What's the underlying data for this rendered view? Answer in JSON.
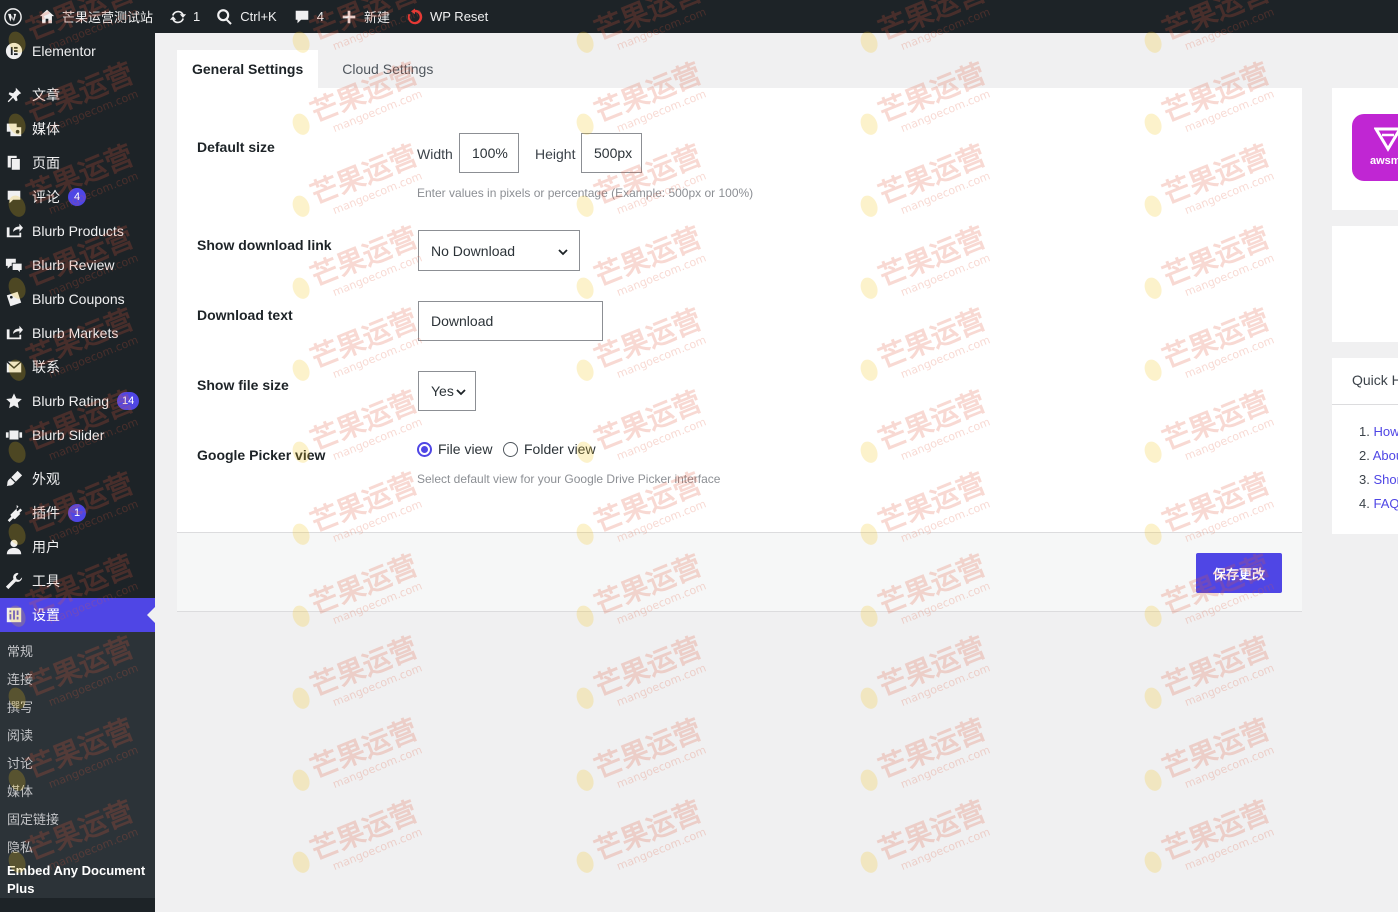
{
  "admin_bar": {
    "site_name": "芒果运营测试站",
    "updates_count": "1",
    "search_shortcut": "Ctrl+K",
    "comments_count": "4",
    "new_label": "新建",
    "wp_reset_label": "WP Reset"
  },
  "sidebar": {
    "elementor": "Elementor",
    "posts": "文章",
    "media": "媒体",
    "pages": "页面",
    "comments": "评论",
    "comments_badge": "4",
    "blurb_products": "Blurb Products",
    "blurb_review": "Blurb Review",
    "blurb_coupons": "Blurb Coupons",
    "blurb_markets": "Blurb Markets",
    "contact": "联系",
    "blurb_rating": "Blurb Rating",
    "blurb_rating_badge": "14",
    "blurb_slider": "Blurb Slider",
    "appearance": "外观",
    "plugins": "插件",
    "plugins_badge": "1",
    "users": "用户",
    "tools": "工具",
    "settings": "设置",
    "submenu": [
      "常规",
      "连接",
      "撰写",
      "阅读",
      "讨论",
      "媒体",
      "固定链接",
      "隐私"
    ],
    "submenu_current": "Embed Any Document Plus"
  },
  "tabs": {
    "general": "General Settings",
    "cloud": "Cloud Settings"
  },
  "form": {
    "default_size_label": "Default size",
    "width_label": "Width",
    "width_value": "100%",
    "height_label": "Height",
    "height_value": "500px",
    "size_help": "Enter values in pixels or percentage (Example: 500px or 100%)",
    "download_link_label": "Show download link",
    "download_link_value": "No Download",
    "download_text_label": "Download text",
    "download_text_value": "Download",
    "file_size_label": "Show file size",
    "file_size_value": "Yes",
    "picker_view_label": "Google Picker view",
    "file_view": "File view",
    "folder_view": "Folder view",
    "picker_help": "Select default view for your Google Drive Picker interface"
  },
  "footer": {
    "save_button": "保存更改"
  },
  "right_panel": {
    "logo_text": "awsm",
    "quick_help_title": "Quick H",
    "items": [
      {
        "num": "1.",
        "text": "How"
      },
      {
        "num": "2.",
        "text": "Abou"
      },
      {
        "num": "3.",
        "text": "Shor"
      },
      {
        "num": "4.",
        "text": "FAQs"
      }
    ]
  },
  "watermark": {
    "title": "芒果运营",
    "domain": "mangoecom.com"
  },
  "colors": {
    "accent": "#4f46e5",
    "admin_dark": "#1d2327",
    "logo_tile": "#c026d3"
  }
}
